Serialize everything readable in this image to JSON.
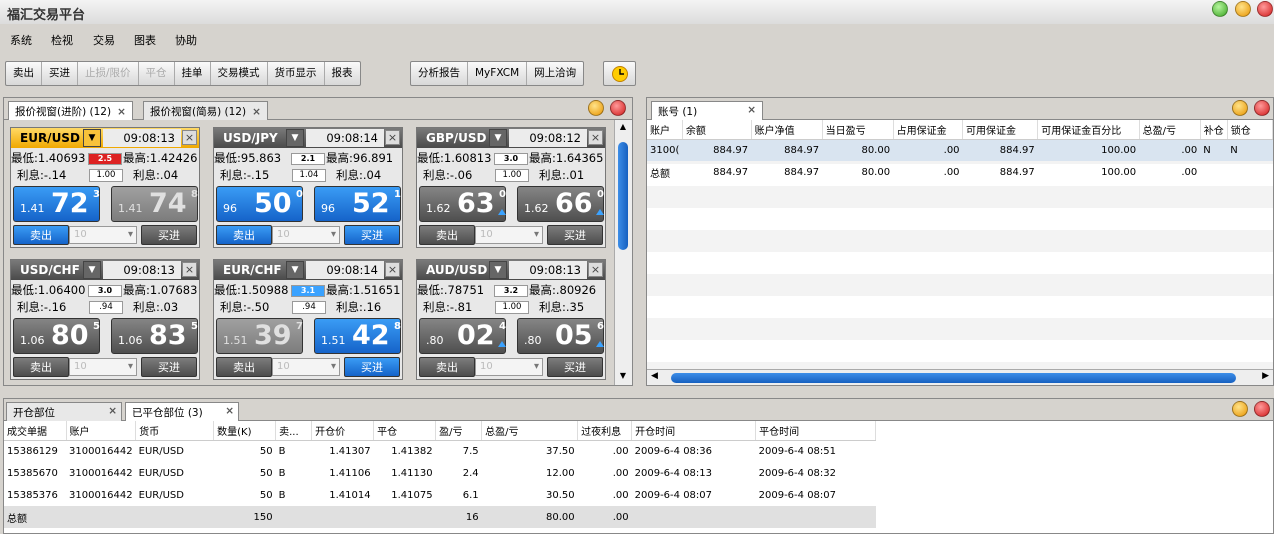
{
  "app": {
    "title": "福汇交易平台"
  },
  "menu": [
    "系统",
    "检视",
    "交易",
    "图表",
    "协助"
  ],
  "toolbar": {
    "group1": [
      {
        "label": "卖出",
        "enabled": true
      },
      {
        "label": "买进",
        "enabled": true
      },
      {
        "label": "止损/限价",
        "enabled": false
      },
      {
        "label": "平仓",
        "enabled": false
      },
      {
        "label": "挂单",
        "enabled": true
      },
      {
        "label": "交易模式",
        "enabled": true
      },
      {
        "label": "货币显示",
        "enabled": true
      },
      {
        "label": "报表",
        "enabled": true
      }
    ],
    "group2": [
      {
        "label": "分析报告"
      },
      {
        "label": "MyFXCM"
      },
      {
        "label": "网上洽询"
      }
    ],
    "clock_icon": "clock-icon"
  },
  "quotes_panel": {
    "tabs": [
      {
        "label": "报价视窗(进阶) (12)",
        "active": true
      },
      {
        "label": "报价视窗(简易) (12)",
        "active": false
      }
    ],
    "cards": [
      {
        "symbol": "EUR/USD",
        "time": "09:08:13",
        "low": "最低:1.40693",
        "spread": "2.5",
        "spread_style": "red",
        "high": "最高:1.42426",
        "rate_sell": "利息:-.14",
        "amount": "1.00",
        "rate_buy": "利息:.04",
        "sell_small": "1.41",
        "sell_big": "72",
        "sell_pip": "3",
        "sell_style": "blue",
        "buy_small": "1.41",
        "buy_big": "74",
        "buy_pip": "8",
        "buy_style": "dim",
        "sell_label": "卖出",
        "buy_label": "买进",
        "qty": "10",
        "highlight": true,
        "sell_btn": "blue",
        "buy_btn": "gray"
      },
      {
        "symbol": "USD/JPY",
        "time": "09:08:14",
        "low": "最低:95.863",
        "spread": "2.1",
        "spread_style": "white",
        "high": "最高:96.891",
        "rate_sell": "利息:-.15",
        "amount": "1.04",
        "rate_buy": "利息:.04",
        "sell_small": "96",
        "sell_big": "50",
        "sell_pip": "0",
        "sell_style": "blue",
        "buy_small": "96",
        "buy_big": "52",
        "buy_pip": "1",
        "buy_style": "blue",
        "sell_label": "卖出",
        "buy_label": "买进",
        "qty": "10",
        "highlight": false,
        "sell_btn": "blue",
        "buy_btn": "blue"
      },
      {
        "symbol": "GBP/USD",
        "time": "09:08:12",
        "low": "最低:1.60813",
        "spread": "3.0",
        "spread_style": "white",
        "high": "最高:1.64365",
        "rate_sell": "利息:-.06",
        "amount": "1.00",
        "rate_buy": "利息:.01",
        "sell_small": "1.62",
        "sell_big": "63",
        "sell_pip": "0",
        "sell_style": "gray",
        "buy_small": "1.62",
        "buy_big": "66",
        "buy_pip": "0",
        "buy_style": "gray",
        "sell_label": "卖出",
        "buy_label": "买进",
        "qty": "10",
        "highlight": false,
        "sell_btn": "gray",
        "buy_btn": "gray",
        "sell_tri": true,
        "buy_tri": true
      },
      {
        "symbol": "USD/CHF",
        "time": "09:08:13",
        "low": "最低:1.06400",
        "spread": "3.0",
        "spread_style": "white",
        "high": "最高:1.07683",
        "rate_sell": "利息:-.16",
        "amount": ".94",
        "rate_buy": "利息:.03",
        "sell_small": "1.06",
        "sell_big": "80",
        "sell_pip": "5",
        "sell_style": "gray",
        "buy_small": "1.06",
        "buy_big": "83",
        "buy_pip": "5",
        "buy_style": "gray",
        "sell_label": "卖出",
        "buy_label": "买进",
        "qty": "10",
        "highlight": false,
        "sell_btn": "gray",
        "buy_btn": "gray"
      },
      {
        "symbol": "EUR/CHF",
        "time": "09:08:14",
        "low": "最低:1.50988",
        "spread": "3.1",
        "spread_style": "blue",
        "high": "最高:1.51651",
        "rate_sell": "利息:-.50",
        "amount": ".94",
        "rate_buy": "利息:.16",
        "sell_small": "1.51",
        "sell_big": "39",
        "sell_pip": "7",
        "sell_style": "dim",
        "buy_small": "1.51",
        "buy_big": "42",
        "buy_pip": "8",
        "buy_style": "blue",
        "sell_label": "卖出",
        "buy_label": "买进",
        "qty": "10",
        "highlight": false,
        "sell_btn": "gray",
        "buy_btn": "blue"
      },
      {
        "symbol": "AUD/USD",
        "time": "09:08:13",
        "low": "最低:.78751",
        "spread": "3.2",
        "spread_style": "white",
        "high": "最高:.80926",
        "rate_sell": "利息:-.81",
        "amount": "1.00",
        "rate_buy": "利息:.35",
        "sell_small": ".80",
        "sell_big": "02",
        "sell_pip": "4",
        "sell_style": "gray",
        "buy_small": ".80",
        "buy_big": "05",
        "buy_pip": "6",
        "buy_style": "gray",
        "sell_label": "卖出",
        "buy_label": "买进",
        "qty": "10",
        "highlight": false,
        "sell_btn": "gray",
        "buy_btn": "gray",
        "sell_tri": true,
        "buy_tri": true
      }
    ]
  },
  "account_panel": {
    "tab": "账号 (1)",
    "headers": [
      "账户",
      "余额",
      "账户净值",
      "当日盈亏",
      "占用保证金",
      "可用保证金",
      "可用保证金百分比",
      "总盈/亏",
      "补仓",
      "锁仓"
    ],
    "rows": [
      [
        "3100(",
        "884.97",
        "884.97",
        "80.00",
        ".00",
        "884.97",
        "100.00",
        ".00",
        "N",
        "N"
      ],
      [
        "总额",
        "884.97",
        "884.97",
        "80.00",
        ".00",
        "884.97",
        "100.00",
        ".00",
        "",
        ""
      ]
    ]
  },
  "trades_panel": {
    "tabs": [
      {
        "label": "开仓部位",
        "active": false
      },
      {
        "label": "已平仓部位 (3)",
        "active": true
      }
    ],
    "headers": [
      "成交单据",
      "账户",
      "货币",
      "数量(K)",
      "卖...",
      "开仓价",
      "平仓",
      "盈/亏",
      "总盈/亏",
      "过夜利息",
      "开仓时间",
      "平仓时间"
    ],
    "rows": [
      [
        "15386129",
        "3100016442",
        "EUR/USD",
        "50",
        "B",
        "1.41307",
        "1.41382",
        "7.5",
        "37.50",
        ".00",
        "2009-6-4 08:36",
        "2009-6-4 08:51"
      ],
      [
        "15385670",
        "3100016442",
        "EUR/USD",
        "50",
        "B",
        "1.41106",
        "1.41130",
        "2.4",
        "12.00",
        ".00",
        "2009-6-4 08:13",
        "2009-6-4 08:32"
      ],
      [
        "15385376",
        "3100016442",
        "EUR/USD",
        "50",
        "B",
        "1.41014",
        "1.41075",
        "6.1",
        "30.50",
        ".00",
        "2009-6-4 08:07",
        "2009-6-4 08:07"
      ]
    ],
    "total": [
      "总额",
      "",
      "",
      "150",
      "",
      "",
      "",
      "16",
      "80.00",
      ".00",
      "",
      ""
    ]
  }
}
